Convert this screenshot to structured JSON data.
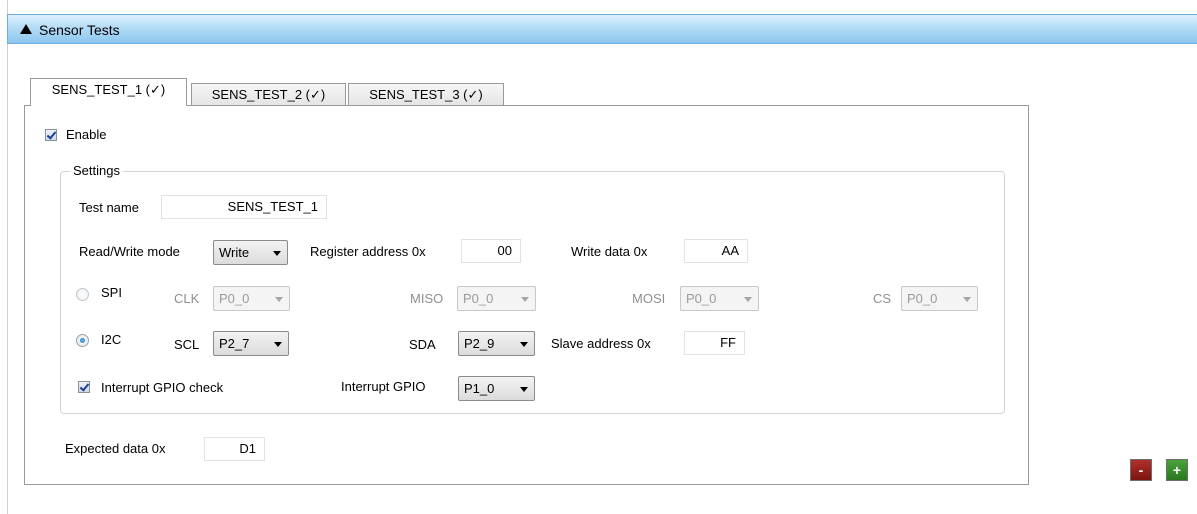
{
  "header": {
    "title": "Sensor Tests"
  },
  "tabs": [
    {
      "label": "SENS_TEST_1 (✓)",
      "active": true
    },
    {
      "label": "SENS_TEST_2 (✓)",
      "active": false
    },
    {
      "label": "SENS_TEST_3 (✓)",
      "active": false
    }
  ],
  "enable": {
    "label": "Enable",
    "checked": true
  },
  "settings": {
    "legend": "Settings",
    "test_name": {
      "label": "Test name",
      "value": "SENS_TEST_1"
    },
    "rw_mode": {
      "label": "Read/Write mode",
      "value": "Write"
    },
    "register_address": {
      "label": "Register address  0x",
      "value": "00"
    },
    "write_data": {
      "label": "Write data  0x",
      "value": "AA"
    },
    "spi": {
      "label": "SPI",
      "selected": false,
      "clk": {
        "label": "CLK",
        "value": "P0_0"
      },
      "miso": {
        "label": "MISO",
        "value": "P0_0"
      },
      "mosi": {
        "label": "MOSI",
        "value": "P0_0"
      },
      "cs": {
        "label": "CS",
        "value": "P0_0"
      }
    },
    "i2c": {
      "label": "I2C",
      "selected": true,
      "scl": {
        "label": "SCL",
        "value": "P2_7"
      },
      "sda": {
        "label": "SDA",
        "value": "P2_9"
      },
      "slave_address": {
        "label": "Slave address  0x",
        "value": "FF"
      }
    },
    "interrupt_check": {
      "label": "Interrupt GPIO check",
      "checked": true
    },
    "interrupt_gpio": {
      "label": "Interrupt GPIO",
      "value": "P1_0"
    }
  },
  "expected_data": {
    "label": "Expected data  0x",
    "value": "D1"
  },
  "buttons": {
    "remove": "-",
    "add": "+"
  },
  "colors": {
    "header_blue": "#8cc6ee",
    "remove_red": "#9b1f1a",
    "add_green": "#3a8f2e"
  }
}
